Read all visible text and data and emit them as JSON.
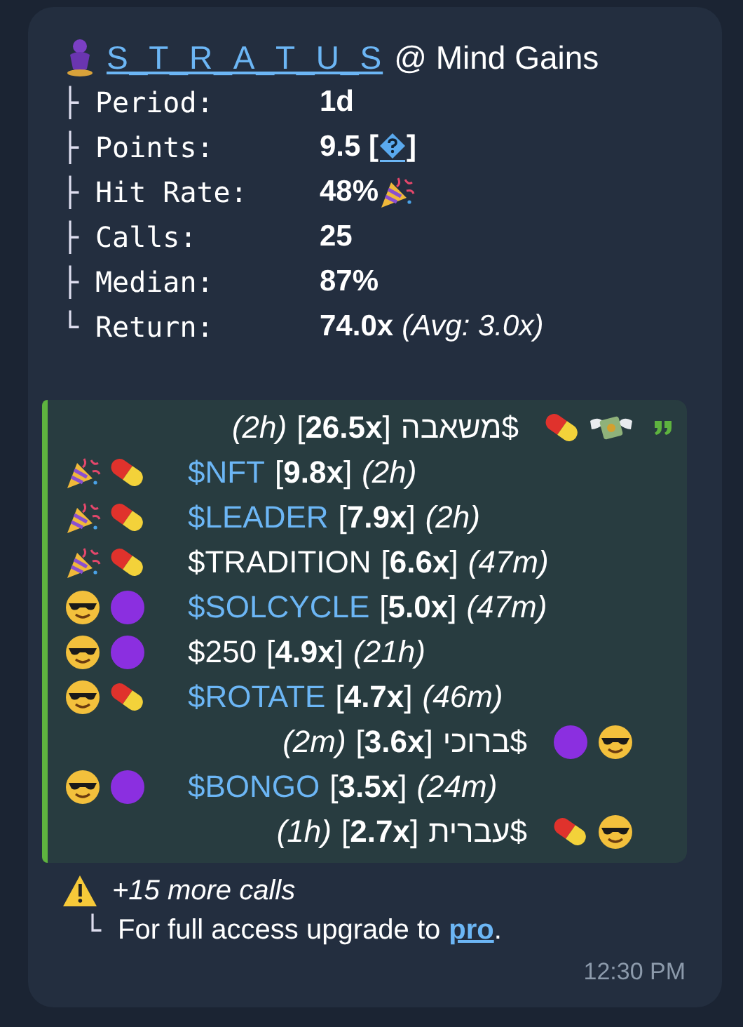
{
  "message": {
    "header": {
      "badge": {
        "kind": "genie"
      },
      "name": "S_T_R_A_T_U_S",
      "suffix": "@ Mind Gains"
    },
    "stats": [
      {
        "branch": "├",
        "label": "Period:",
        "value": "1d"
      },
      {
        "branch": "├",
        "label": "Points:",
        "value": "9.5 [",
        "badge": {
          "kind": "question"
        },
        "after": "]"
      },
      {
        "branch": "├",
        "label": "Hit Rate:",
        "value": "48%",
        "badge": {
          "kind": "party"
        }
      },
      {
        "branch": "├",
        "label": "Calls:",
        "value": "25"
      },
      {
        "branch": "├",
        "label": "Median:",
        "value": "87%"
      },
      {
        "branch": "└",
        "label": "Return:",
        "value": "74.0x",
        "note": "(Avg: 3.0x)"
      }
    ],
    "quote": {
      "calls": [
        {
          "rtl": true,
          "emojis": [
            {
              "kind": "money"
            },
            {
              "kind": "pill"
            }
          ],
          "ticker": "$משאבה",
          "linked": false,
          "mult": "[**26.5x**]",
          "age": "(2h)"
        },
        {
          "rtl": false,
          "emojis": [
            {
              "kind": "party"
            },
            {
              "kind": "pill"
            }
          ],
          "ticker": "$NFT",
          "linked": true,
          "mult": "[**9.8x**]",
          "age": "(2h)"
        },
        {
          "rtl": false,
          "emojis": [
            {
              "kind": "party"
            },
            {
              "kind": "pill"
            }
          ],
          "ticker": "$LEADER",
          "linked": true,
          "mult": "[**7.9x**]",
          "age": "(2h)"
        },
        {
          "rtl": false,
          "emojis": [
            {
              "kind": "party"
            },
            {
              "kind": "pill"
            }
          ],
          "ticker": "$TRADITION",
          "linked": false,
          "mult": "[**6.6x**]",
          "age": "(47m)"
        },
        {
          "rtl": false,
          "emojis": [
            {
              "kind": "cool"
            },
            {
              "kind": "circle"
            }
          ],
          "ticker": "$SOLCYCLE",
          "linked": true,
          "mult": "[**5.0x**]",
          "age": "(47m)"
        },
        {
          "rtl": false,
          "emojis": [
            {
              "kind": "cool"
            },
            {
              "kind": "circle"
            }
          ],
          "ticker": "$250",
          "linked": false,
          "mult": "[**4.9x**]",
          "age": "(21h)"
        },
        {
          "rtl": false,
          "emojis": [
            {
              "kind": "cool"
            },
            {
              "kind": "pill"
            }
          ],
          "ticker": "$ROTATE",
          "linked": true,
          "mult": "[**4.7x**]",
          "age": "(46m)"
        },
        {
          "rtl": true,
          "emojis": [
            {
              "kind": "cool"
            },
            {
              "kind": "circle"
            }
          ],
          "ticker": "$ברוכי",
          "linked": false,
          "mult": "[**3.6x**]",
          "age": "(2m)"
        },
        {
          "rtl": false,
          "emojis": [
            {
              "kind": "cool"
            },
            {
              "kind": "circle"
            }
          ],
          "ticker": "$BONGO",
          "linked": true,
          "mult": "[**3.5x**]",
          "age": "(24m)"
        },
        {
          "rtl": true,
          "emojis": [
            {
              "kind": "cool"
            },
            {
              "kind": "pill"
            }
          ],
          "ticker": "$עברית",
          "linked": false,
          "mult": "[**2.7x**]",
          "age": "(1h)"
        }
      ]
    },
    "more": {
      "badge": {
        "kind": "warning"
      },
      "text": "+15 more calls"
    },
    "footer": {
      "branch": "└",
      "text": "For full access upgrade to",
      "link": "pro",
      "end": "."
    },
    "time": "12:30 PM"
  }
}
